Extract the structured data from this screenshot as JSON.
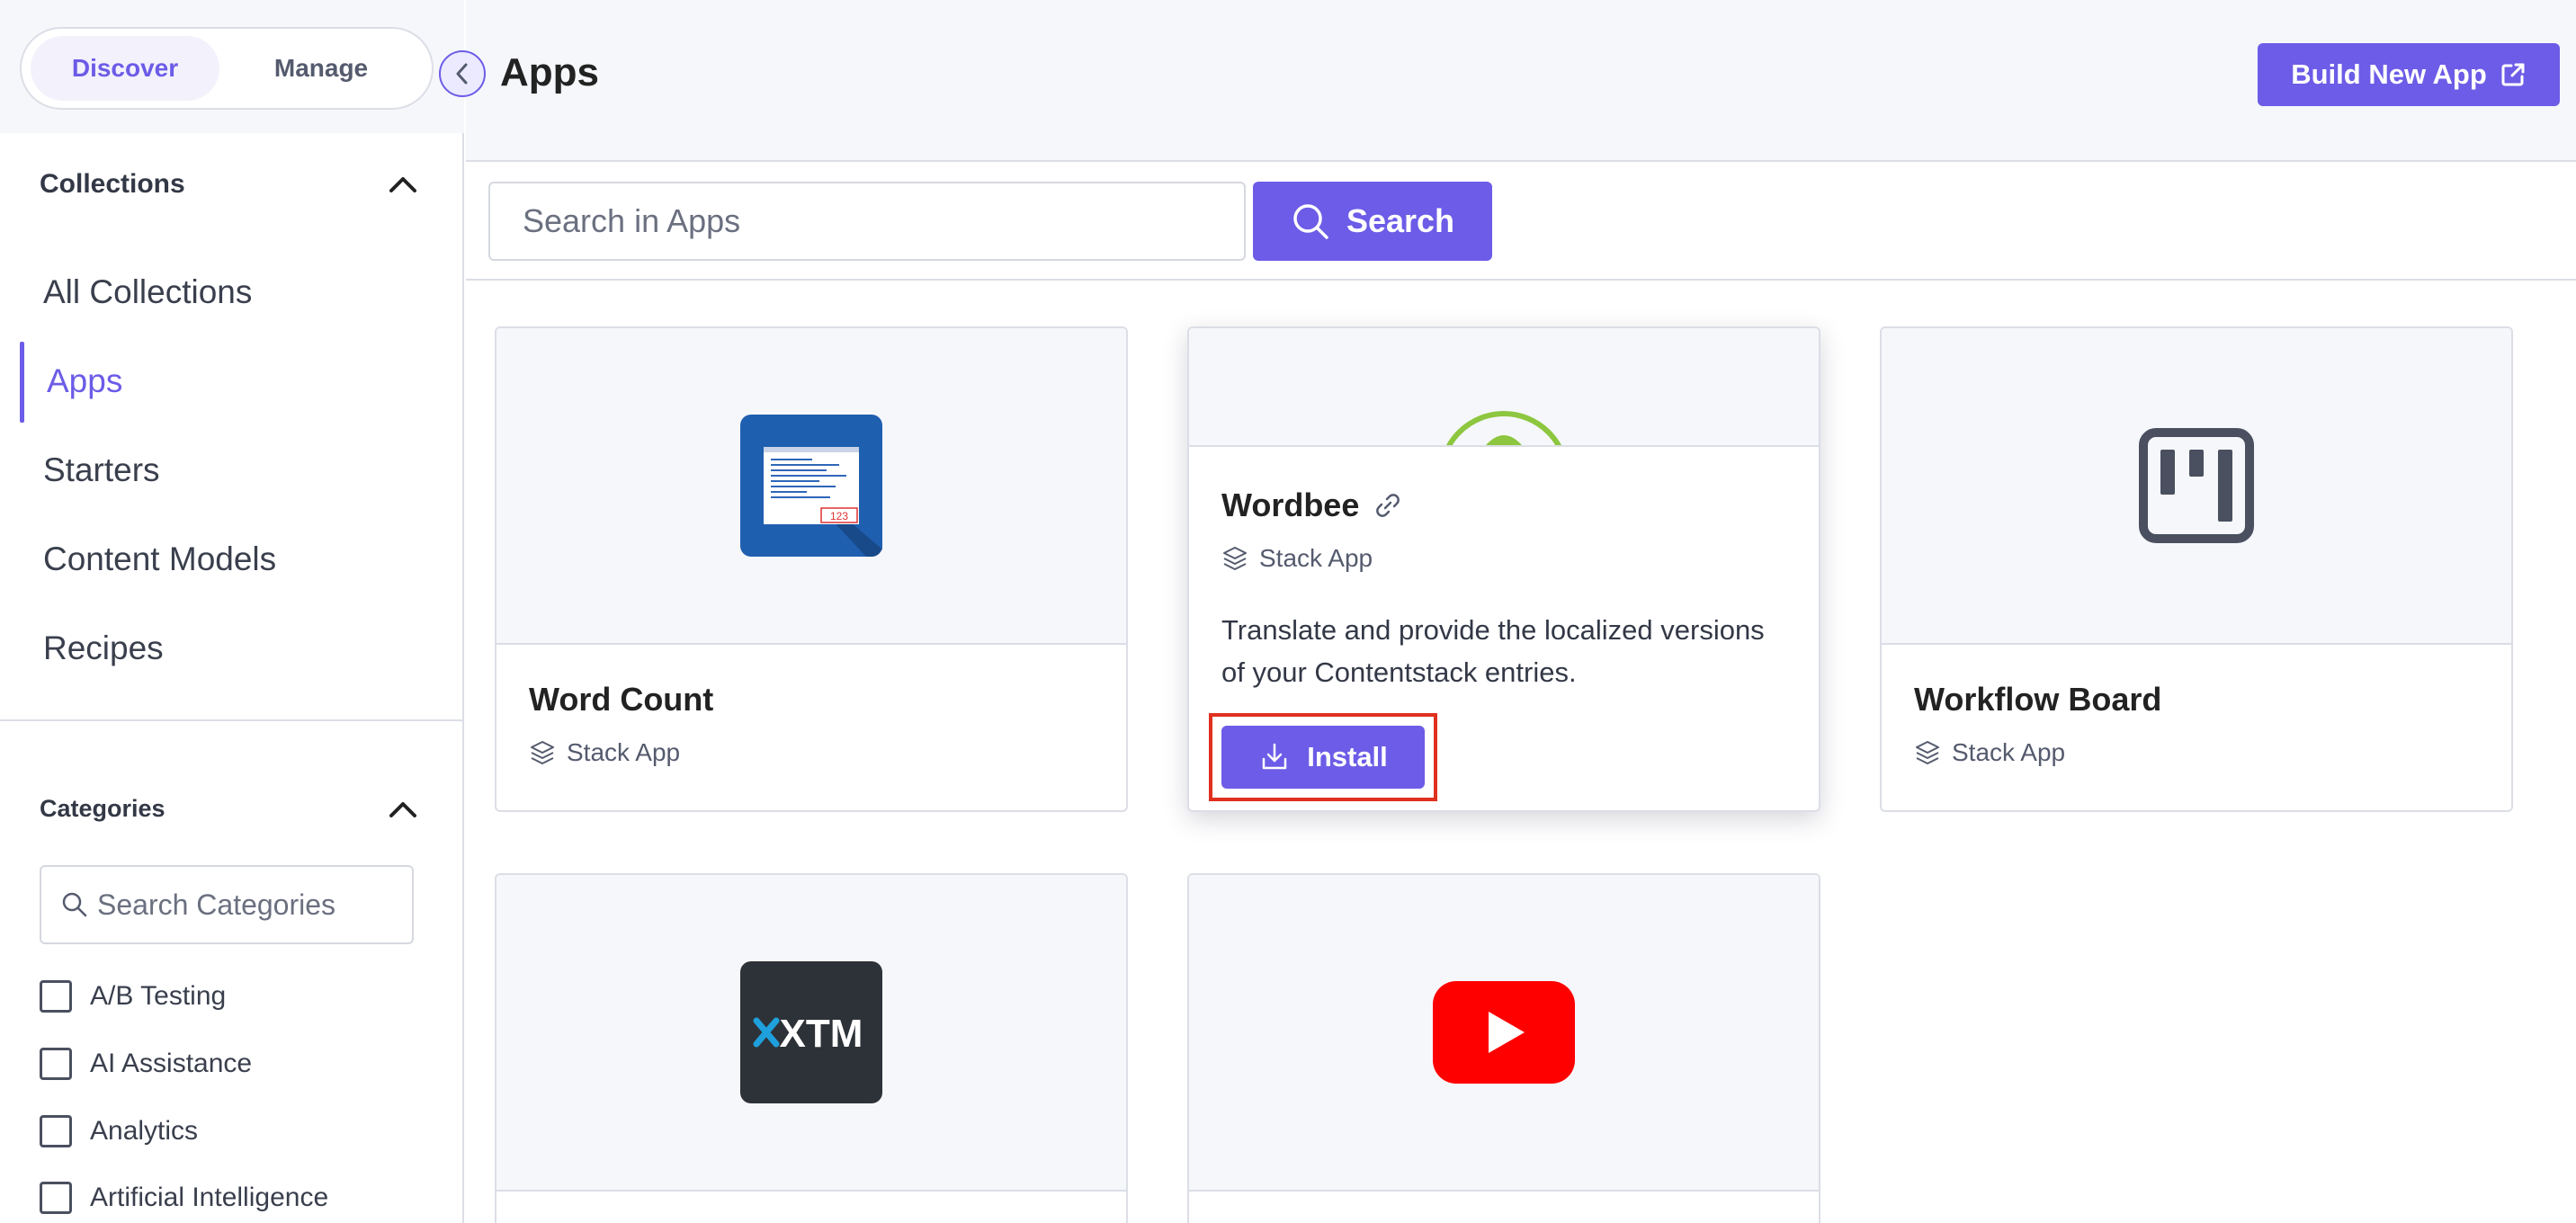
{
  "sidebar": {
    "tabs": {
      "discover": "Discover",
      "manage": "Manage"
    },
    "collections": {
      "heading": "Collections",
      "items": [
        "All Collections",
        "Apps",
        "Starters",
        "Content Models",
        "Recipes"
      ],
      "active": "Apps"
    },
    "categories": {
      "heading": "Categories",
      "search_placeholder": "Search Categories",
      "items": [
        "A/B Testing",
        "AI Assistance",
        "Analytics",
        "Artificial Intelligence"
      ]
    }
  },
  "header": {
    "title": "Apps",
    "build_button": "Build New App"
  },
  "search": {
    "placeholder": "Search in Apps",
    "button": "Search"
  },
  "cards": [
    {
      "title": "Word Count",
      "type": "Stack App",
      "icon": "word-count-icon"
    },
    {
      "title": "Wordbee",
      "type": "Stack App",
      "icon": "wordbee-icon",
      "description": "Translate and provide the localized versions of your Contentstack entries.",
      "action": "Install"
    },
    {
      "title": "Workflow Board",
      "type": "Stack App",
      "icon": "workflow-board-icon"
    },
    {
      "title": "",
      "type": "",
      "icon": "xtm-icon",
      "logo_text": "XTM"
    },
    {
      "title": "",
      "type": "",
      "icon": "youtube-icon"
    }
  ],
  "colors": {
    "accent": "#6c5ce7",
    "highlight_border": "#e0301e",
    "youtube_red": "#ff0000",
    "xtm_dark": "#2d3239",
    "xtm_blue": "#1ea0dc",
    "word_count_blue": "#1f5fb0"
  }
}
